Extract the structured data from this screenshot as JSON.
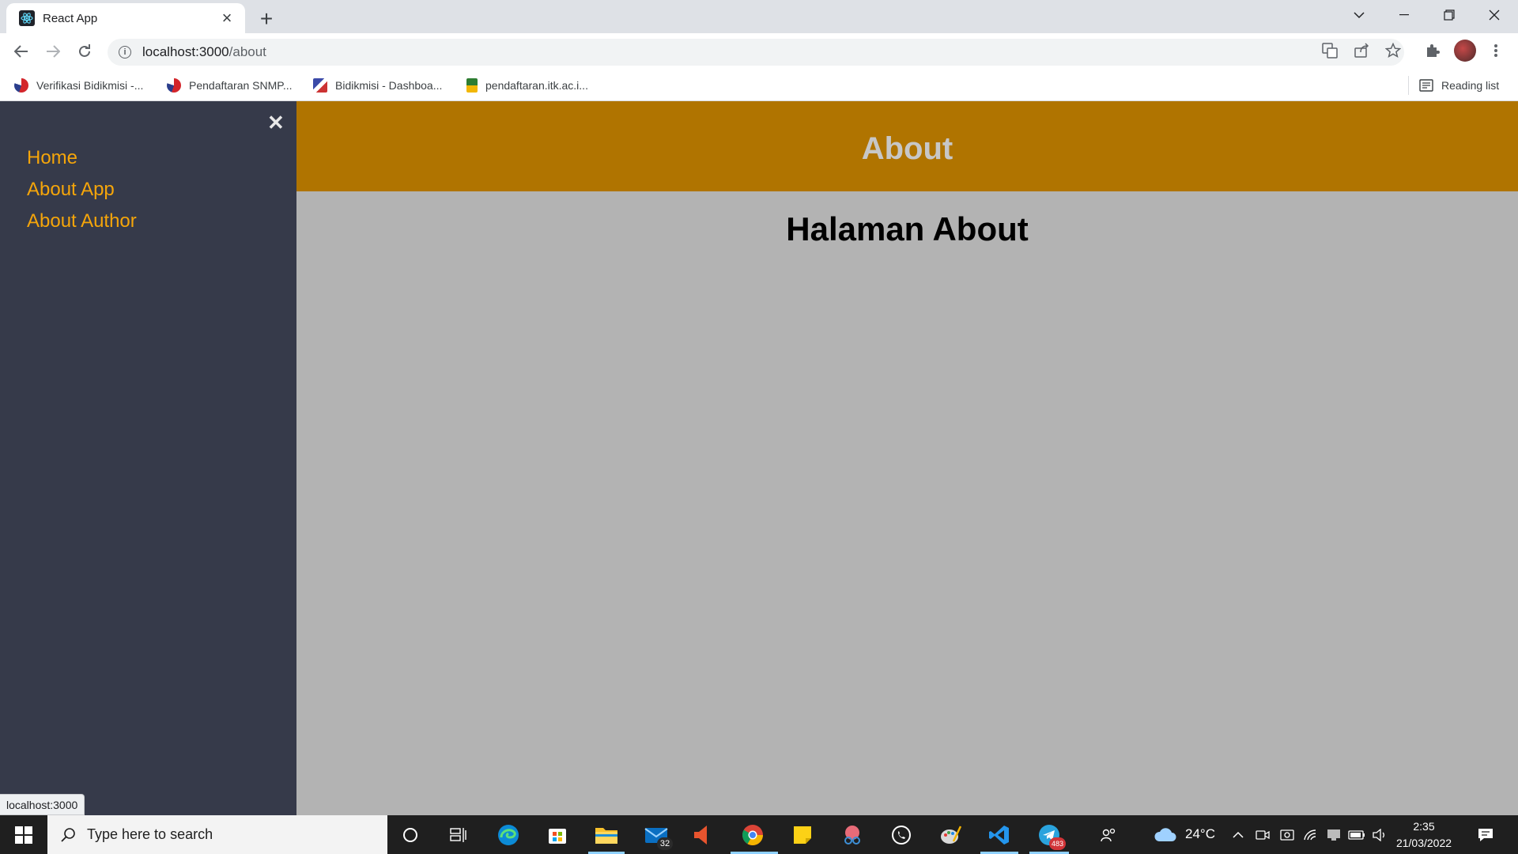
{
  "browser": {
    "tab_title": "React App",
    "url_host": "localhost:3000",
    "url_path": "/about",
    "bookmarks": [
      {
        "label": "Verifikasi Bidikmisi -..."
      },
      {
        "label": "Pendaftaran SNMP..."
      },
      {
        "label": "Bidikmisi - Dashboa..."
      },
      {
        "label": "pendaftaran.itk.ac.i..."
      }
    ],
    "reading_list": "Reading list",
    "status_url": "localhost:3000"
  },
  "sidebar": {
    "close_glyph": "✕",
    "links": [
      {
        "label": "Home"
      },
      {
        "label": "About App"
      },
      {
        "label": "About Author"
      }
    ]
  },
  "header": {
    "title": "About"
  },
  "main": {
    "heading": "Halaman About"
  },
  "taskbar": {
    "search_placeholder": "Type here to search",
    "mail_badge": "32",
    "telegram_badge": "483",
    "temperature": "24°C",
    "time": "2:35",
    "date": "21/03/2022"
  },
  "colors": {
    "sidebar_bg": "#363a4a",
    "link": "#f5a50a",
    "header_bg": "#b07400",
    "main_bg": "#b3b3b3"
  }
}
